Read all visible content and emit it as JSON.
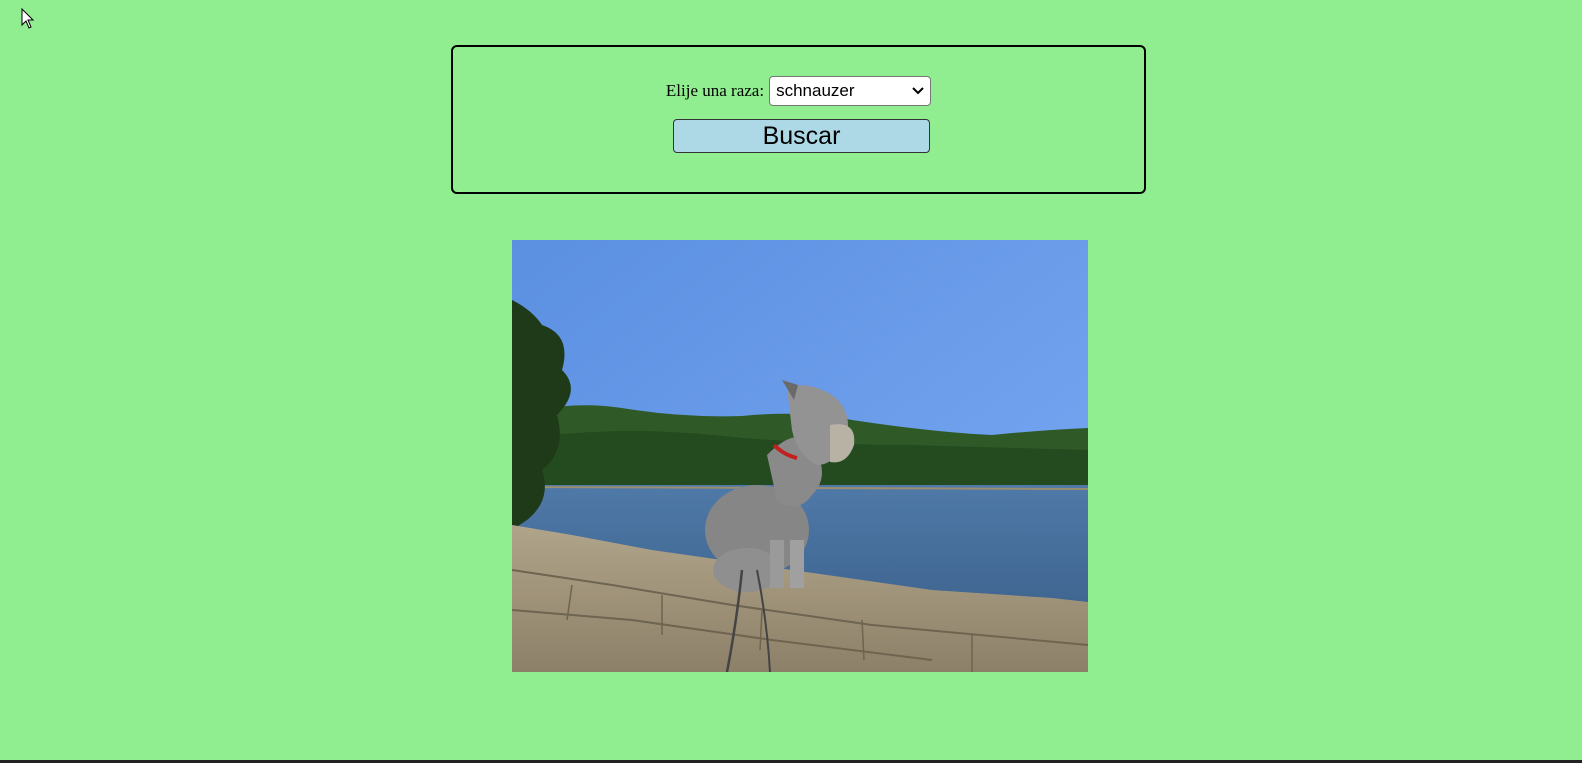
{
  "background_color": "#90ee90",
  "form": {
    "breed_label": "Elije una raza:",
    "selected_breed": "schnauzer",
    "select_icon": "chevron-down-icon",
    "search_button_label": "Buscar",
    "button_color": "#add8e6"
  },
  "result_image": {
    "subject": "schnauzer dog sitting on stone wall by a lake"
  }
}
